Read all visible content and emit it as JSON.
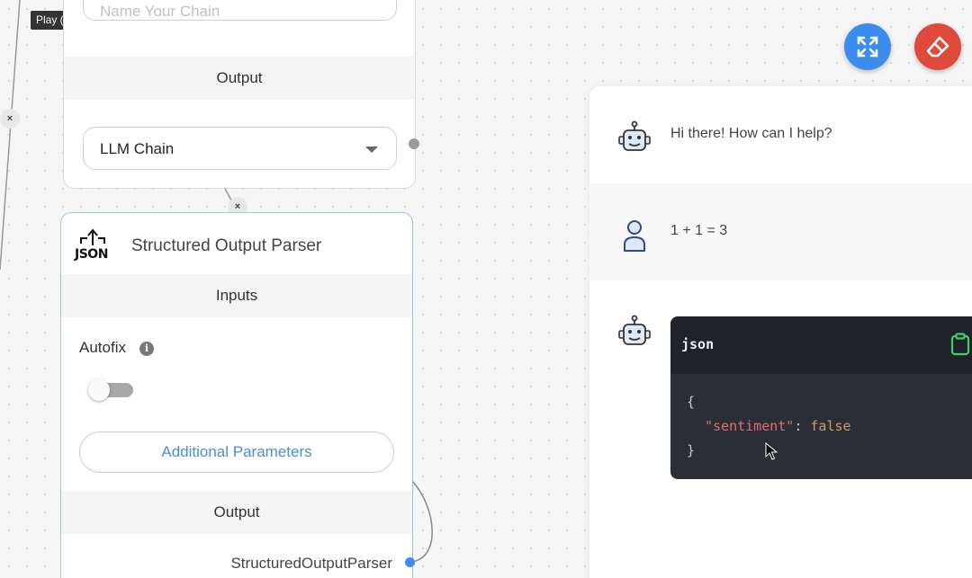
{
  "tooltip": "Play (k)",
  "top_node": {
    "name_placeholder": "Name Your Chain",
    "output_header": "Output",
    "chain_select_value": "LLM Chain"
  },
  "parser_node": {
    "logo_text": "JSON",
    "title": "Structured Output Parser",
    "inputs_header": "Inputs",
    "autofix_label": "Autofix",
    "info_glyph": "i",
    "autofix_enabled": false,
    "additional_params_label": "Additional Parameters",
    "output_header": "Output",
    "output_name": "StructuredOutputParser"
  },
  "remove_glyph": "×",
  "colors": {
    "accent_blue": "#3b8ded",
    "danger_red": "#e04a3c",
    "link_blue": "#4a8fd1",
    "clipboard_green": "#3ecf6a"
  },
  "chat": {
    "messages": [
      {
        "role": "bot",
        "text": "Hi there! How can I help?"
      },
      {
        "role": "user",
        "text": "1 + 1 = 3"
      },
      {
        "role": "bot",
        "code_lang": "json",
        "code": {
          "open": "{",
          "key": "\"sentiment\"",
          "colon": ": ",
          "value": "false",
          "close": "}"
        }
      }
    ]
  }
}
